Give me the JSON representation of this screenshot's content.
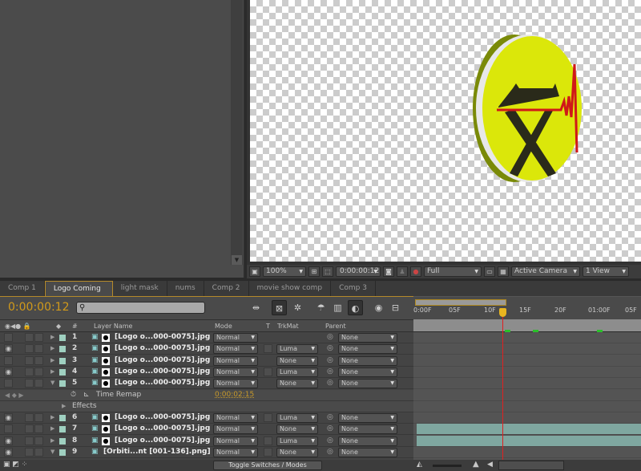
{
  "viewer": {
    "zoom": "100%",
    "timecode": "0:00:00:12",
    "resolution": "Full",
    "camera": "Active Camera",
    "views": "1 View"
  },
  "tabs": [
    {
      "label": "Comp 1"
    },
    {
      "label": "Logo Coming",
      "active": true
    },
    {
      "label": "light mask"
    },
    {
      "label": "nums"
    },
    {
      "label": "Comp 2"
    },
    {
      "label": "movie show comp"
    },
    {
      "label": "Comp 3"
    }
  ],
  "timeline": {
    "current_time": "0:00:00:12",
    "search_placeholder": "",
    "columns": {
      "num": "#",
      "layer_name": "Layer Name",
      "mode": "Mode",
      "t": "T",
      "trkmat": "TrkMat",
      "parent": "Parent"
    },
    "ruler": [
      "0:00F",
      "05F",
      "10F",
      "15F",
      "20F",
      "01:00F",
      "05F"
    ],
    "layers": [
      {
        "num": "1",
        "name": "[Logo o...000-0075].jpg",
        "mode": "Normal",
        "trkmat": null,
        "parent": "None",
        "visible": false,
        "expanded": false
      },
      {
        "num": "2",
        "name": "[Logo o...000-0075].jpg",
        "mode": "Normal",
        "trkmat": "Luma",
        "parent": "None",
        "visible": true,
        "expanded": false
      },
      {
        "num": "3",
        "name": "[Logo o...000-0075].jpg",
        "mode": "Normal",
        "trkmat": "None",
        "parent": "None",
        "visible": false,
        "expanded": false
      },
      {
        "num": "4",
        "name": "[Logo o...000-0075].jpg",
        "mode": "Normal",
        "trkmat": "Luma",
        "parent": "None",
        "visible": true,
        "expanded": false
      },
      {
        "num": "5",
        "name": "[Logo o...000-0075].jpg",
        "mode": "Normal",
        "trkmat": "None",
        "parent": "None",
        "visible": false,
        "expanded": true
      },
      {
        "num": "6",
        "name": "[Logo o...000-0075].jpg",
        "mode": "Normal",
        "trkmat": "Luma",
        "parent": "None",
        "visible": true,
        "expanded": false
      },
      {
        "num": "7",
        "name": "[Logo o...000-0075].jpg",
        "mode": "Normal",
        "trkmat": "None",
        "parent": "None",
        "visible": false,
        "expanded": false
      },
      {
        "num": "8",
        "name": "[Logo o...000-0075].jpg",
        "mode": "Normal",
        "trkmat": "Luma",
        "parent": "None",
        "visible": true,
        "expanded": false
      },
      {
        "num": "9",
        "name": "[Orbiti...nt [001-136].png]",
        "mode": "Normal",
        "trkmat": "None",
        "parent": "None",
        "visible": true,
        "expanded": true
      }
    ],
    "time_remap": {
      "label": "Time Remap",
      "value": "0:00:02:15"
    },
    "effects_label": "Effects",
    "toggle_label": "Toggle Switches / Modes"
  },
  "colors": {
    "accent": "#d29a1a",
    "layer_label": "#9fd0c0",
    "track_bar": "#7fa7a0",
    "playhead": "#e02020"
  }
}
